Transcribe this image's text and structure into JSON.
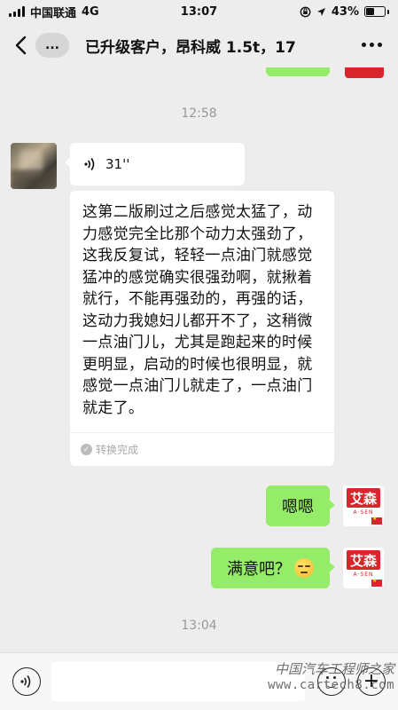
{
  "status_bar": {
    "carrier": "中国联通",
    "network": "4G",
    "time": "13:07",
    "battery": "43%",
    "battery_level": 0.43
  },
  "nav": {
    "unread": "...",
    "title": "已升级客户，昂科威 1.5t，17"
  },
  "timestamps": {
    "first": "12:58",
    "second": "13:04"
  },
  "voice_message": {
    "duration": "31''"
  },
  "transcript": {
    "text": "这第二版刷过之后感觉太猛了，动力感觉完全比那个动力太强劲了，这我反复试，轻轻一点油门就感觉猛冲的感觉确实很强劲啊，就揪着就行，不能再强劲的，再强的话，这动力我媳妇儿都开不了，这稍微一点油门儿，尤其是跑起来的时候更明显，启动的时候也很明显，就感觉一点油门儿就走了，一点油门就走了。",
    "status": "转换完成"
  },
  "reply1": {
    "text": "嗯嗯"
  },
  "reply2": {
    "text": "满意吧？"
  },
  "brand_avatar": {
    "logo_text": "艾森",
    "sub_text": "A·SEN"
  },
  "input": {
    "placeholder": ""
  },
  "watermark": {
    "line1": "中国汽车工程师之家",
    "line2": "www.cartech8.com"
  },
  "colors": {
    "background": "#ededed",
    "self_bubble": "#95ec69",
    "other_bubble": "#ffffff",
    "brand_red": "#d9262c"
  }
}
